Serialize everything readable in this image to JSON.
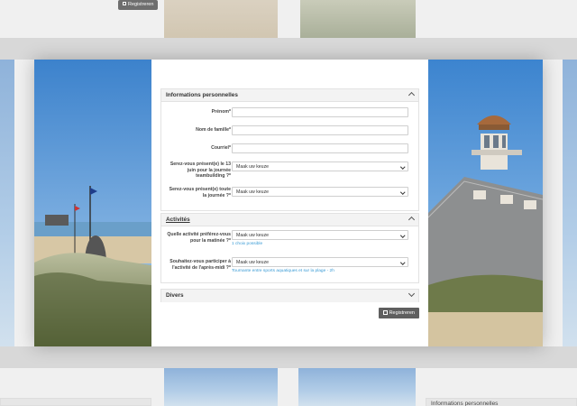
{
  "background": {
    "top_button": "Registreren",
    "bottom_right_header": "Informations personnelles"
  },
  "modal": {
    "sections": {
      "personal": {
        "title": "Informations personnelles",
        "fields": [
          {
            "label": "Prénom*",
            "value": ""
          },
          {
            "label": "Nom de famille*",
            "value": ""
          },
          {
            "label": "Courriel*",
            "value": ""
          },
          {
            "label": "Serez-vous présent(e) le 13 juin pour la journée teambuilding ?*",
            "selected": "Maak uw keuze"
          },
          {
            "label": "Serez-vous présent(e) toute la journée ?*",
            "selected": "Maak uw keuze"
          }
        ]
      },
      "activities": {
        "title": "Activités",
        "fields": [
          {
            "label": "Quelle activité préférez-vous pour la matinée ?*",
            "selected": "Maak uw keuze",
            "hint": "1 choix possible"
          },
          {
            "label": "Souhaitez-vous participer à l'activité de l'après-midi ?*",
            "selected": "Maak uw keuze",
            "hint": "Tournante entre sports aquatiques et sur la plage - 2h"
          }
        ]
      },
      "misc": {
        "title": "Divers"
      }
    },
    "submit_label": "Registreren"
  }
}
